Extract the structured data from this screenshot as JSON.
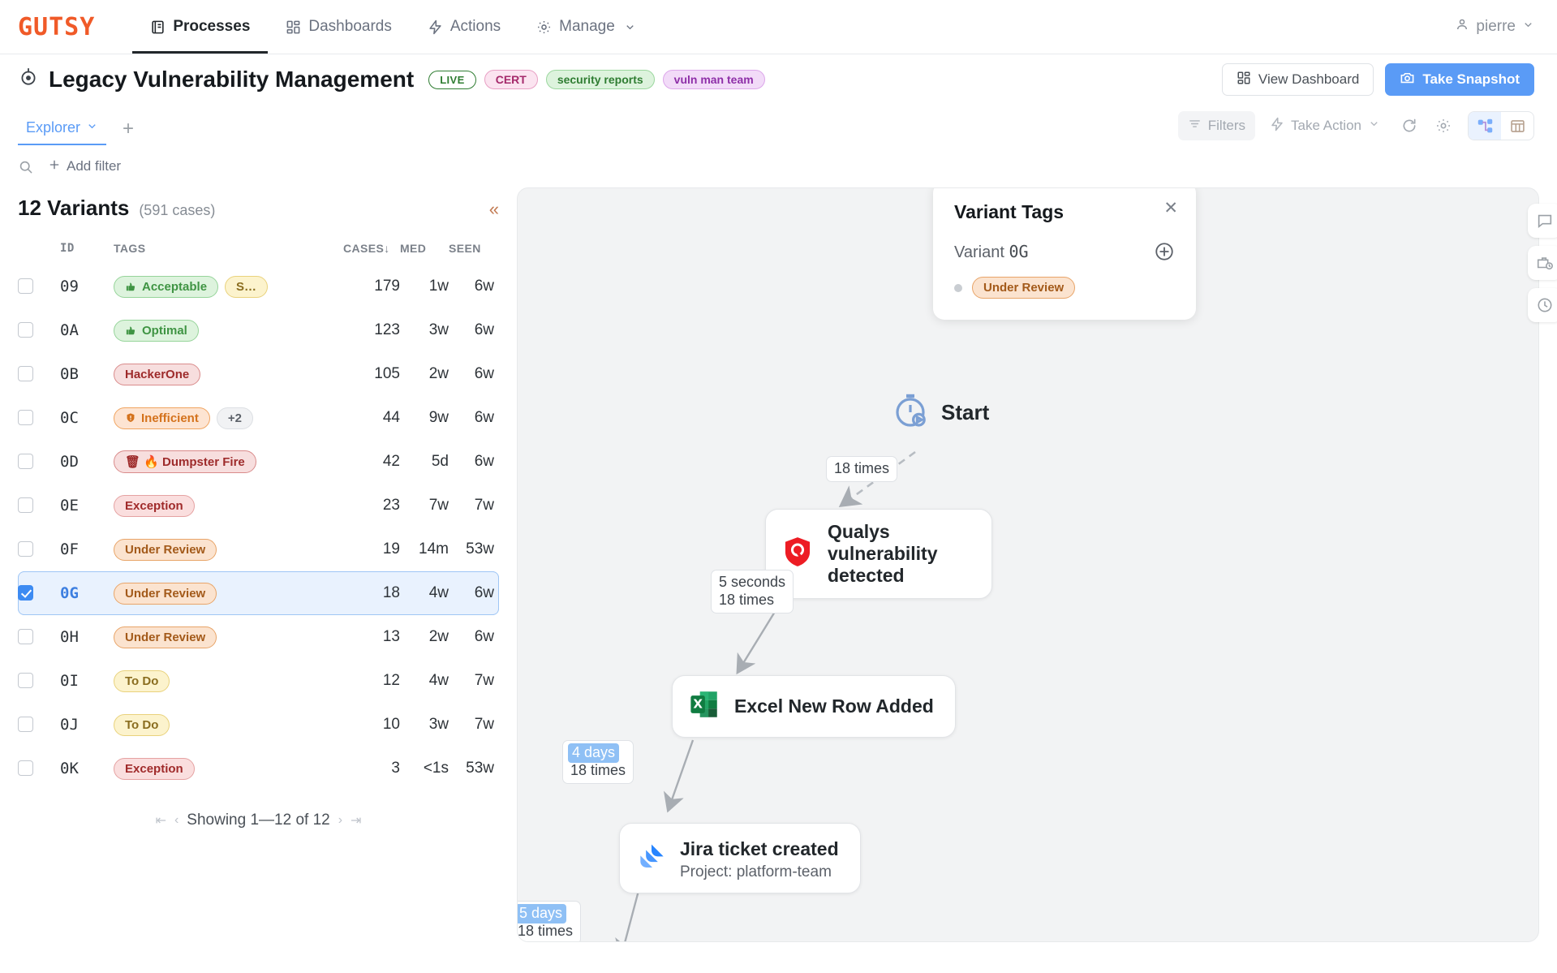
{
  "topnav": {
    "logo": "GUTSY",
    "items": [
      {
        "label": "Processes",
        "icon": "processes-icon",
        "active": true
      },
      {
        "label": "Dashboards",
        "icon": "dashboards-icon",
        "active": false
      },
      {
        "label": "Actions",
        "icon": "bolt-icon",
        "active": false
      },
      {
        "label": "Manage",
        "icon": "gear-icon",
        "active": false,
        "caret": true
      }
    ],
    "user": {
      "name": "pierre",
      "icon": "user-icon"
    }
  },
  "header": {
    "title": "Legacy Vulnerability Management",
    "title_icon": "target-icon",
    "chips": [
      {
        "label": "LIVE",
        "style": "live"
      },
      {
        "label": "CERT",
        "style": "cert"
      },
      {
        "label": "security reports",
        "style": "sec"
      },
      {
        "label": "vuln man team",
        "style": "vuln"
      }
    ],
    "view_dashboard_label": "View Dashboard",
    "take_snapshot_label": "Take Snapshot",
    "accent_color": "#5a9bf6"
  },
  "tabs": {
    "explorer_label": "Explorer",
    "add_tab_label": "+"
  },
  "toolbar": {
    "filters_label": "Filters",
    "take_action_label": "Take Action",
    "refresh_icon": "refresh-icon",
    "settings_icon": "gear-icon",
    "graph_view_icon": "graph-view-icon",
    "table_view_icon": "table-view-icon"
  },
  "filterbar": {
    "search_icon": "search-icon",
    "add_filter_label": "Add filter"
  },
  "variants": {
    "title": "12 Variants",
    "subtitle": "(591 cases)",
    "collapse_icon": "collapse-left-icon",
    "columns": [
      "ID",
      "TAGS",
      "CASES",
      "MED",
      "SEEN"
    ],
    "sort_column": "CASES",
    "sort_dir": "desc",
    "rows": [
      {
        "id": "09",
        "checked": false,
        "tags": [
          {
            "label": "Acceptable",
            "style": "green",
            "icon": "thumbs-up-icon"
          },
          {
            "label": "S…",
            "style": "yellow"
          }
        ],
        "cases": "179",
        "med": "1w",
        "seen": "6w"
      },
      {
        "id": "0A",
        "checked": false,
        "tags": [
          {
            "label": "Optimal",
            "style": "green",
            "icon": "thumbs-up-icon"
          }
        ],
        "cases": "123",
        "med": "3w",
        "seen": "6w"
      },
      {
        "id": "0B",
        "checked": false,
        "tags": [
          {
            "label": "HackerOne",
            "style": "red"
          }
        ],
        "cases": "105",
        "med": "2w",
        "seen": "6w"
      },
      {
        "id": "0C",
        "checked": false,
        "tags": [
          {
            "label": "Inefficient",
            "style": "orangeb",
            "icon": "shield-alert-icon"
          },
          {
            "label": "+2",
            "style": "grey"
          }
        ],
        "cases": "44",
        "med": "9w",
        "seen": "6w"
      },
      {
        "id": "0D",
        "checked": false,
        "tags": [
          {
            "label": "🗑 🔥 Dumpster Fire",
            "style": "red"
          }
        ],
        "cases": "42",
        "med": "5d",
        "seen": "6w"
      },
      {
        "id": "0E",
        "checked": false,
        "tags": [
          {
            "label": "Exception",
            "style": "rose"
          }
        ],
        "cases": "23",
        "med": "7w",
        "seen": "7w"
      },
      {
        "id": "0F",
        "checked": false,
        "tags": [
          {
            "label": "Under Review",
            "style": "orange"
          }
        ],
        "cases": "19",
        "med": "14m",
        "seen": "53w"
      },
      {
        "id": "0G",
        "checked": true,
        "tags": [
          {
            "label": "Under Review",
            "style": "orange"
          }
        ],
        "cases": "18",
        "med": "4w",
        "seen": "6w"
      },
      {
        "id": "0H",
        "checked": false,
        "tags": [
          {
            "label": "Under Review",
            "style": "orange"
          }
        ],
        "cases": "13",
        "med": "2w",
        "seen": "6w"
      },
      {
        "id": "0I",
        "checked": false,
        "tags": [
          {
            "label": "To Do",
            "style": "yellow"
          }
        ],
        "cases": "12",
        "med": "4w",
        "seen": "7w"
      },
      {
        "id": "0J",
        "checked": false,
        "tags": [
          {
            "label": "To Do",
            "style": "yellow"
          }
        ],
        "cases": "10",
        "med": "3w",
        "seen": "7w"
      },
      {
        "id": "0K",
        "checked": false,
        "tags": [
          {
            "label": "Exception",
            "style": "rose"
          }
        ],
        "cases": "3",
        "med": "<1s",
        "seen": "53w"
      }
    ],
    "pagination": {
      "text": "Showing 1—12 of 12"
    }
  },
  "graph": {
    "start_label": "Start",
    "start_icon": "timer-start-icon",
    "nodes": [
      {
        "id": "qualys",
        "label": "Qualys vulnerability detected",
        "sub": "",
        "icon": "qualys-icon"
      },
      {
        "id": "excel",
        "label": "Excel New Row Added",
        "sub": "",
        "icon": "excel-icon"
      },
      {
        "id": "jira",
        "label": "Jira ticket created",
        "sub": "Project: platform-team",
        "icon": "jira-icon"
      }
    ],
    "edges": [
      {
        "id": "e0",
        "line1": "18 times",
        "line2": "",
        "highlight": false
      },
      {
        "id": "e1",
        "line1": "5 seconds",
        "line2": "18 times",
        "highlight": false
      },
      {
        "id": "e2",
        "line1": "4 days",
        "line2": "18 times",
        "highlight": true
      },
      {
        "id": "e3",
        "line1": "5 days",
        "line2": "18 times",
        "highlight": true
      }
    ],
    "rail": [
      {
        "icon": "comment-icon"
      },
      {
        "icon": "briefcase-clock-icon"
      },
      {
        "icon": "history-clock-icon"
      }
    ]
  },
  "variant_tags_panel": {
    "title": "Variant Tags",
    "variant_label": "Variant",
    "variant_id": "0G",
    "close_icon": "close-icon",
    "add_icon": "plus-circle-icon",
    "tags": [
      {
        "label": "Under Review",
        "style": "orange"
      }
    ]
  }
}
